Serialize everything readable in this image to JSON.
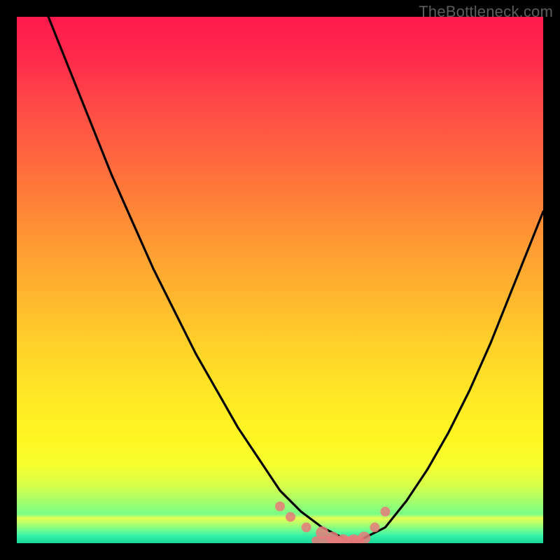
{
  "watermark": "TheBottleneck.com",
  "chart_data": {
    "type": "line",
    "title": "",
    "xlabel": "",
    "ylabel": "",
    "xlim": [
      0,
      100
    ],
    "ylim": [
      0,
      100
    ],
    "series": [
      {
        "name": "bottleneck-curve",
        "x": [
          6,
          10,
          14,
          18,
          22,
          26,
          30,
          34,
          38,
          42,
          46,
          50,
          54,
          58,
          62,
          64,
          66,
          70,
          74,
          78,
          82,
          86,
          90,
          94,
          98,
          100
        ],
        "values": [
          100,
          90,
          80,
          70,
          61,
          52,
          44,
          36,
          29,
          22,
          16,
          10,
          6,
          3,
          1,
          0,
          1,
          3,
          8,
          14,
          21,
          29,
          38,
          48,
          58,
          63
        ]
      }
    ],
    "markers": {
      "name": "highlight-points",
      "x": [
        50,
        52,
        55,
        58,
        60,
        62,
        64,
        66,
        68,
        70
      ],
      "values": [
        7,
        5,
        3,
        2,
        1,
        0.5,
        0.5,
        1,
        3,
        6
      ]
    },
    "gradient_stops": [
      {
        "pos": 0,
        "color": "#ff1a4d"
      },
      {
        "pos": 50,
        "color": "#ffae2f"
      },
      {
        "pos": 80,
        "color": "#fff622"
      },
      {
        "pos": 100,
        "color": "#1de9a0"
      }
    ]
  }
}
